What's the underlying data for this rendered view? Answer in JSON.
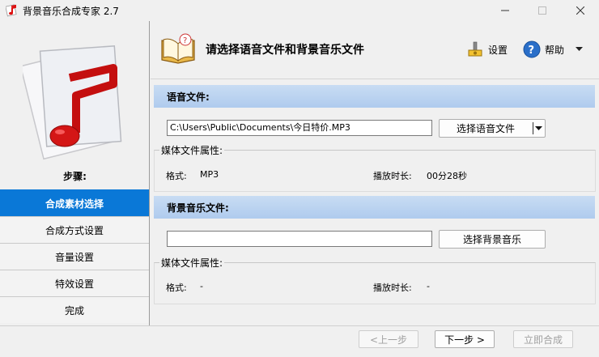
{
  "window": {
    "title": "背景音乐合成专家 2.7"
  },
  "sidebar": {
    "steps_label": "步骤:",
    "items": [
      {
        "label": "合成素材选择",
        "active": true
      },
      {
        "label": "合成方式设置",
        "active": false
      },
      {
        "label": "音量设置",
        "active": false
      },
      {
        "label": "特效设置",
        "active": false
      },
      {
        "label": "完成",
        "active": false
      }
    ]
  },
  "header": {
    "title": "请选择语音文件和背景音乐文件",
    "settings_label": "设置",
    "help_label": "帮助"
  },
  "voice": {
    "section_title": "语音文件:",
    "path_value": "C:\\Users\\Public\\Documents\\今日特价.MP3",
    "choose_button": "选择语音文件",
    "props_title": "媒体文件属性:",
    "format_label": "格式:",
    "format_value": "MP3",
    "duration_label": "播放时长:",
    "duration_value": "00分28秒"
  },
  "bgm": {
    "section_title": "背景音乐文件:",
    "path_value": "",
    "choose_button": "选择背景音乐",
    "props_title": "媒体文件属性:",
    "format_label": "格式:",
    "format_value": "-",
    "duration_label": "播放时长:",
    "duration_value": "-"
  },
  "footer": {
    "prev_label": "<上一步",
    "next_label": "下一步 >",
    "compose_label": "立即合成"
  },
  "colors": {
    "accent": "#0a78d7",
    "section_bar": "#b8d2f0"
  }
}
